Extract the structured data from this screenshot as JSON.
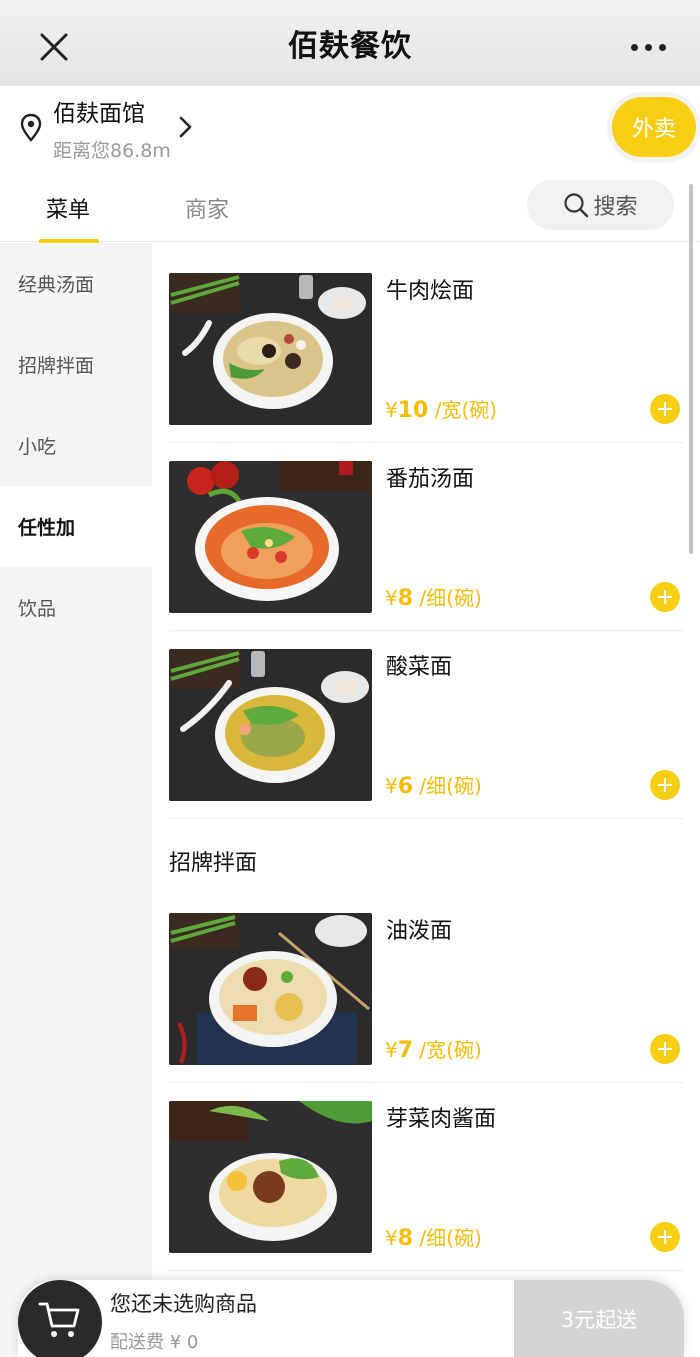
{
  "navbar": {
    "title": "佰麸餐饮",
    "close_icon": "close-icon",
    "more_icon": "more-icon"
  },
  "shop": {
    "name": "佰麸面馆",
    "distance": "距离您86.8m",
    "takeout_label": "外卖"
  },
  "tabs": {
    "menu": "菜单",
    "merchant": "商家",
    "search": "搜索"
  },
  "categories": [
    {
      "label": "经典汤面",
      "active": false
    },
    {
      "label": "招牌拌面",
      "active": false
    },
    {
      "label": "小吃",
      "active": false
    },
    {
      "label": "任性加",
      "active": true
    },
    {
      "label": "饮品",
      "active": false
    }
  ],
  "products": [
    {
      "name": "牛肉烩面",
      "currency": "¥",
      "price": "10",
      "unit": "/宽(碗)"
    },
    {
      "name": "番茄汤面",
      "currency": "¥",
      "price": "8",
      "unit": "/细(碗)"
    },
    {
      "name": "酸菜面",
      "currency": "¥",
      "price": "6",
      "unit": "/细(碗)"
    }
  ],
  "section2": {
    "title": "招牌拌面",
    "products": [
      {
        "name": "油泼面",
        "currency": "¥",
        "price": "7",
        "unit": "/宽(碗)"
      },
      {
        "name": "芽菜肉酱面",
        "currency": "¥",
        "price": "8",
        "unit": "/细(碗)"
      }
    ]
  },
  "cart": {
    "empty_text": "您还未选购商品",
    "delivery_fee": "配送费 ¥ 0",
    "min_order": "3元起送"
  },
  "colors": {
    "accent": "#f8cf14",
    "price": "#f6bd0a",
    "sidebar_bg": "#f5f5f5",
    "disabled_button": "#d4d4d4"
  }
}
